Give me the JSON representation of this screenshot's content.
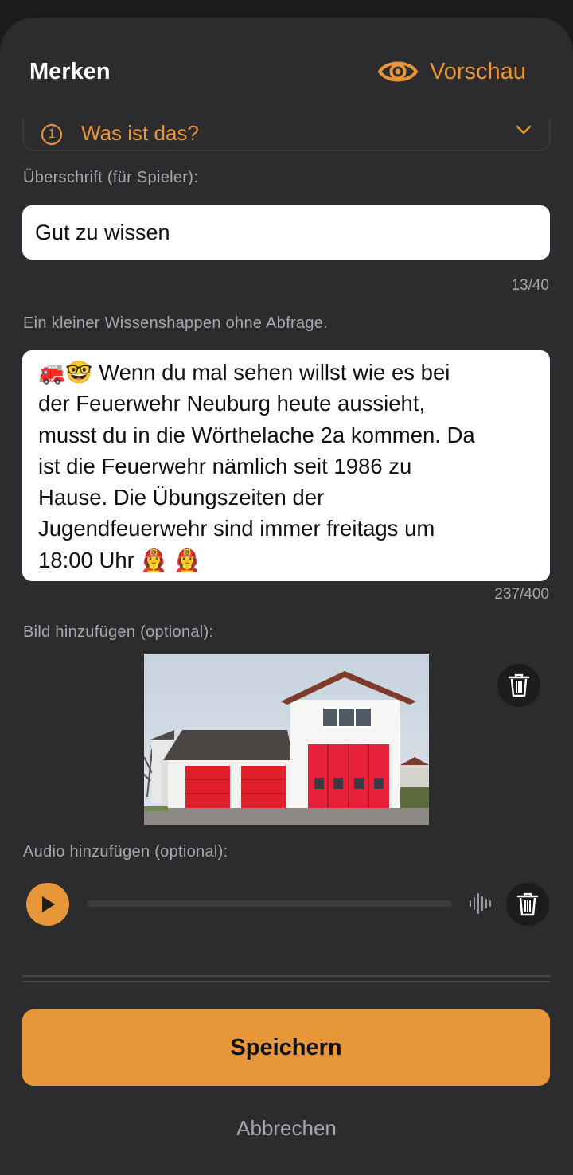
{
  "header": {
    "title": "Merken",
    "preview_label": "Vorschau"
  },
  "info": {
    "label": "Was ist das?"
  },
  "headline_field": {
    "label": "Überschrift (für Spieler):",
    "value": "Gut zu wissen",
    "counter": "13/40"
  },
  "text_field": {
    "label": "Ein kleiner Wissenshappen ohne Abfrage.",
    "lines": [
      "🚒🤓 Wenn du mal sehen willst wie es bei",
      "der Feuerwehr Neuburg heute aussieht,",
      "musst du in die Wörthelache 2a kommen. Da",
      "ist die Feuerwehr nämlich seit 1986 zu",
      "Hause. Die Übungszeiten der",
      "Jugendfeuerwehr sind immer freitags um",
      "18:00 Uhr 👩‍🚒 👩‍🚒"
    ],
    "counter": "237/400"
  },
  "image_section": {
    "label": "Bild hinzufügen (optional):"
  },
  "audio_section": {
    "label": "Audio hinzufügen (optional):",
    "progress": 0
  },
  "actions": {
    "save_label": "Speichern",
    "cancel_label": "Abbrechen"
  },
  "colors": {
    "accent": "#e8963a",
    "background": "#2c2c2e",
    "field": "#ffffff",
    "muted_text": "#a8a8ac"
  },
  "icons": [
    "eye-icon",
    "info-icon",
    "chevron-down-icon",
    "trash-icon",
    "play-icon",
    "waveform-icon"
  ]
}
